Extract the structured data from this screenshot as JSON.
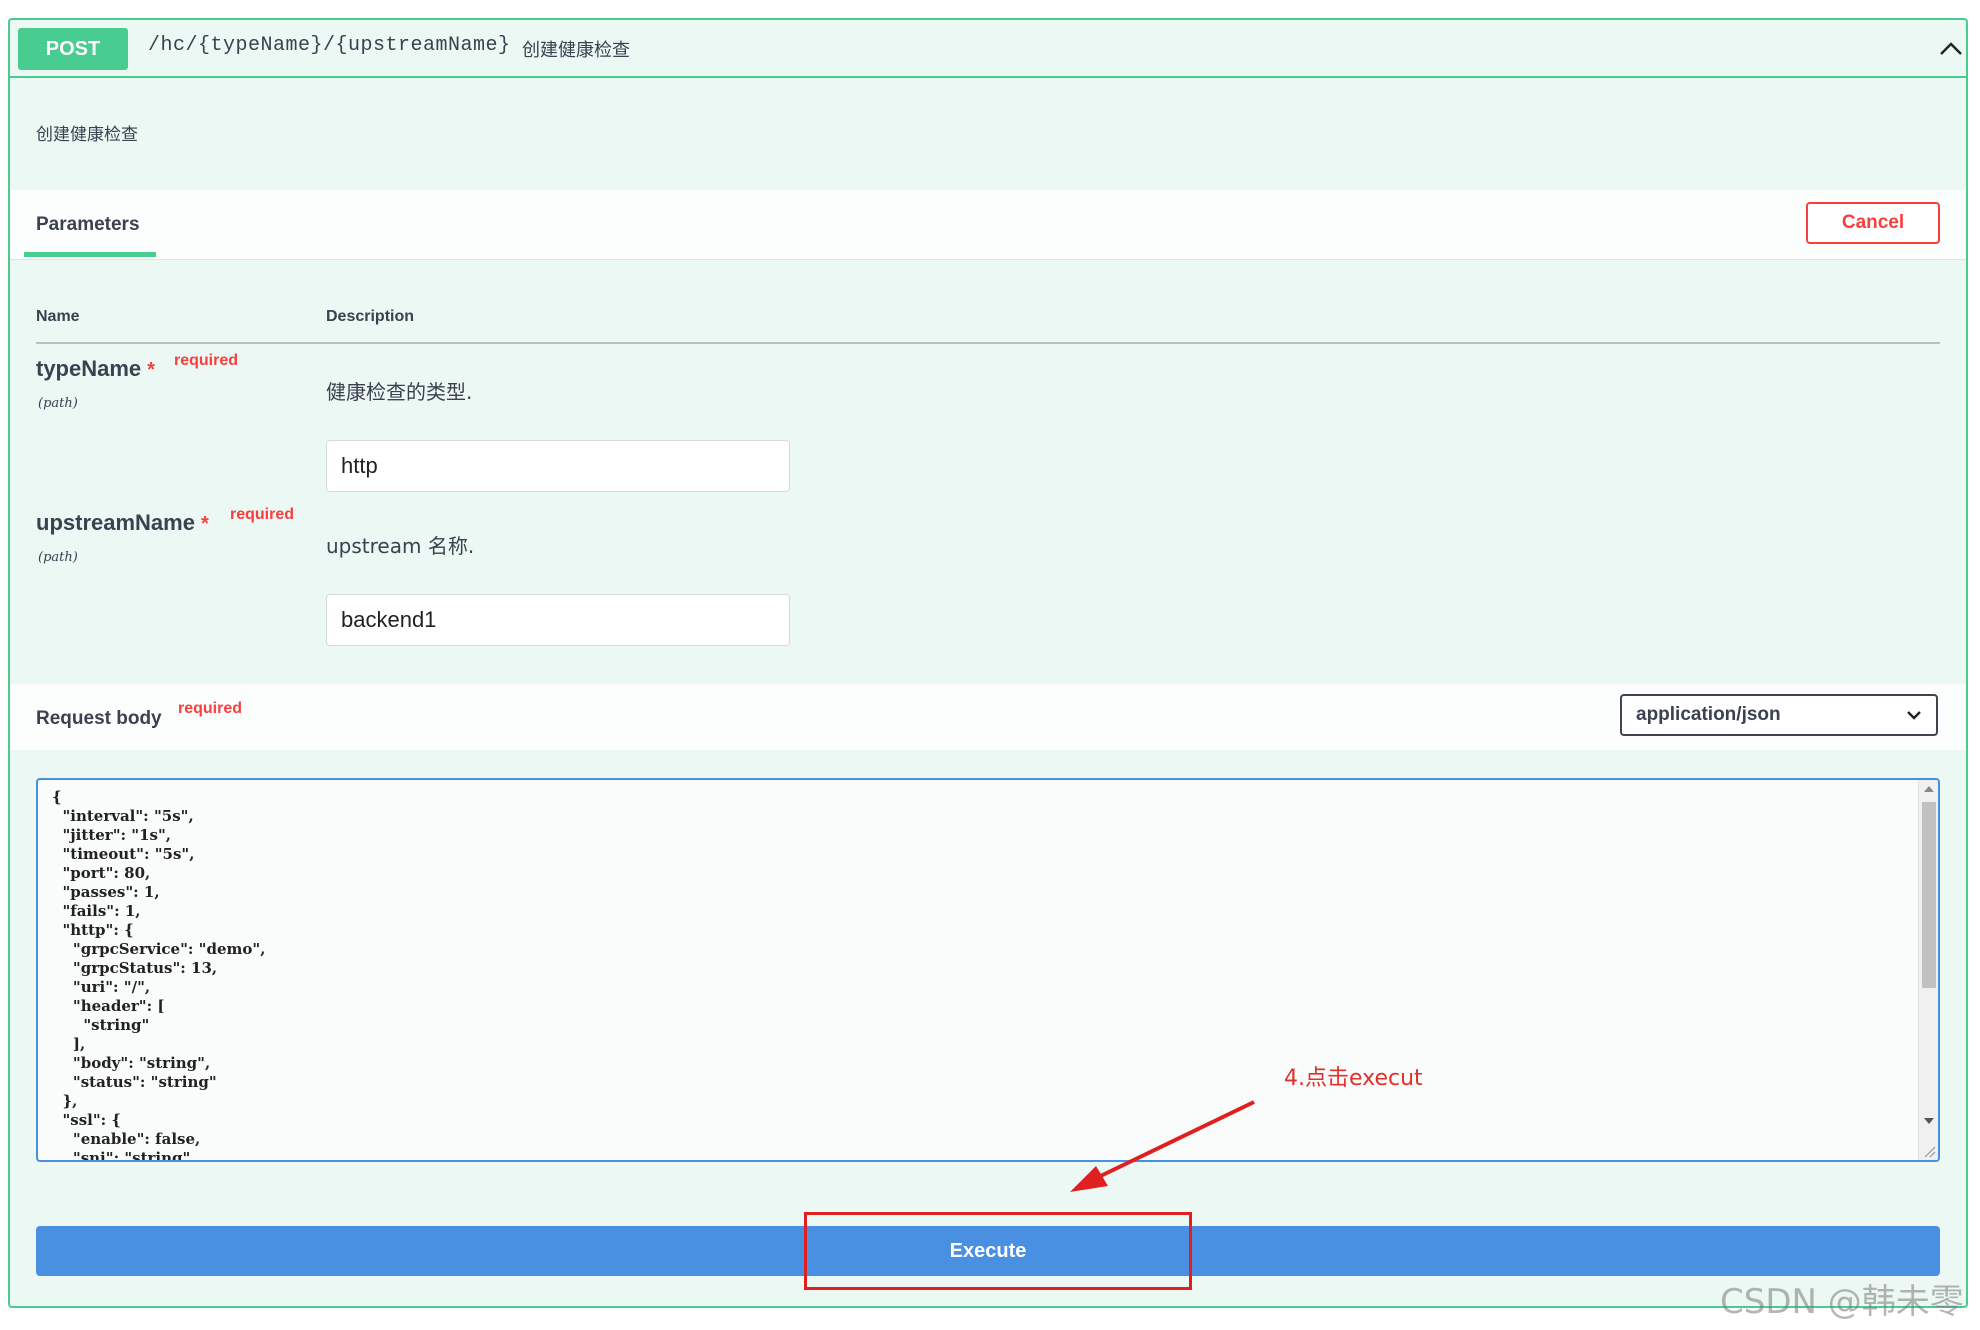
{
  "operation": {
    "method": "POST",
    "path": "/hc/{typeName}/{upstreamName}",
    "summary": "创建健康检查",
    "description": "创建健康检查"
  },
  "parameters_section": {
    "tab_label": "Parameters",
    "cancel_label": "Cancel",
    "col_name": "Name",
    "col_description": "Description",
    "params": [
      {
        "name": "typeName",
        "star": "*",
        "required_label": "required",
        "in": "(path)",
        "description": "健康检查的类型.",
        "value": "http"
      },
      {
        "name": "upstreamName",
        "star": "*",
        "required_label": "required",
        "in": "(path)",
        "description": "upstream 名称.",
        "value": "backend1"
      }
    ]
  },
  "request_body": {
    "title": "Request body",
    "required_label": "required",
    "content_type": "application/json",
    "json_text": "{\n  \"interval\": \"5s\",\n  \"jitter\": \"1s\",\n  \"timeout\": \"5s\",\n  \"port\": 80,\n  \"passes\": 1,\n  \"fails\": 1,\n  \"http\": {\n    \"grpcService\": \"demo\",\n    \"grpcStatus\": 13,\n    \"uri\": \"/\",\n    \"header\": [\n      \"string\"\n    ],\n    \"body\": \"string\",\n    \"status\": \"string\"\n  },\n  \"ssl\": {\n    \"enable\": false,\n    \"sni\": \"string\""
  },
  "execute_label": "Execute",
  "annotation": {
    "text": "4.点击execut"
  },
  "watermark": "CSDN @韩未零",
  "colors": {
    "post_green": "#49cc90",
    "execute_blue": "#4990e2",
    "cancel_red": "#f93e3e",
    "annotation_red": "#e02020"
  }
}
